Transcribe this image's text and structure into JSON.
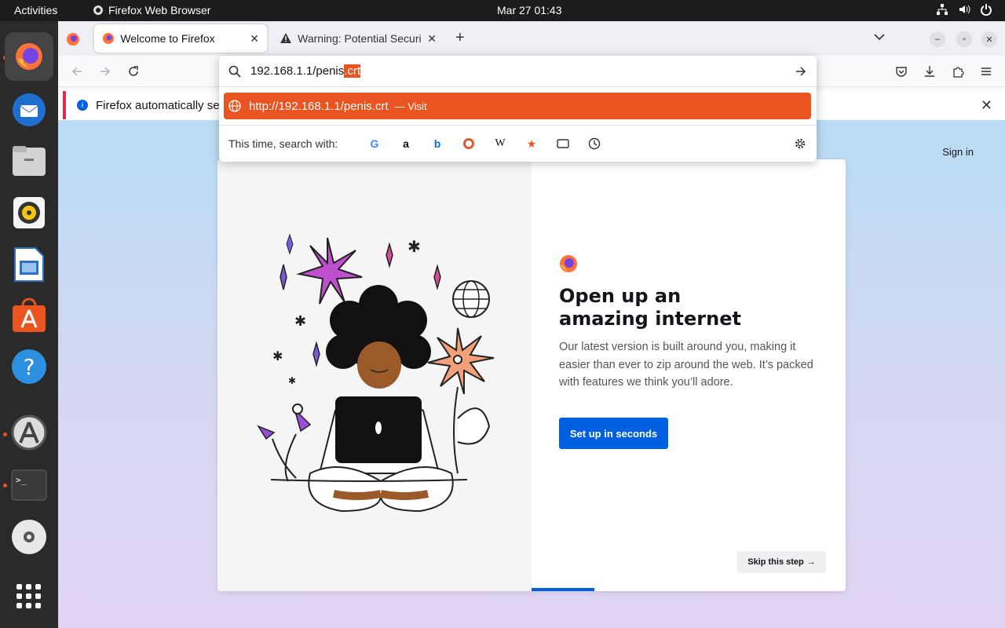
{
  "topbar": {
    "activities": "Activities",
    "app_name": "Firefox Web Browser",
    "clock": "Mar 27  01:43",
    "tray_icons": [
      "network-icon",
      "volume-icon",
      "power-icon"
    ]
  },
  "dock": {
    "items": [
      "firefox",
      "thunderbird",
      "files",
      "rhythmbox",
      "libreoffice-writer",
      "app-center",
      "help",
      "software-updater",
      "terminal",
      "dvd",
      "show-apps"
    ]
  },
  "tabs": [
    {
      "label": "Welcome to Firefox",
      "selected": true
    },
    {
      "label": "Warning: Potential Securi",
      "selected": false
    }
  ],
  "urlbar": {
    "typed_prefix": "192.168.1.1/penis",
    "typed_selected": ".crt",
    "suggestion_url": "http://192.168.1.1/penis.crt",
    "suggestion_action": "— Visit",
    "search_with_label": "This time, search with:",
    "engines": [
      "Google",
      "Amazon",
      "Bing",
      "DuckDuckGo",
      "Wikipedia",
      "bookmarks",
      "tabs",
      "history"
    ]
  },
  "notice": {
    "text": "Firefox automatically se"
  },
  "page": {
    "signin": "Sign in",
    "heading": "Open up an amazing internet",
    "body": "Our latest version is built around you, making it easier than ever to zip around the web. It’s packed with features we think you’ll adore.",
    "primary_button": "Set up in seconds",
    "skip_button": "Skip this step"
  },
  "colors": {
    "accent_orange": "#e95420",
    "firefox_blue": "#0060df"
  }
}
